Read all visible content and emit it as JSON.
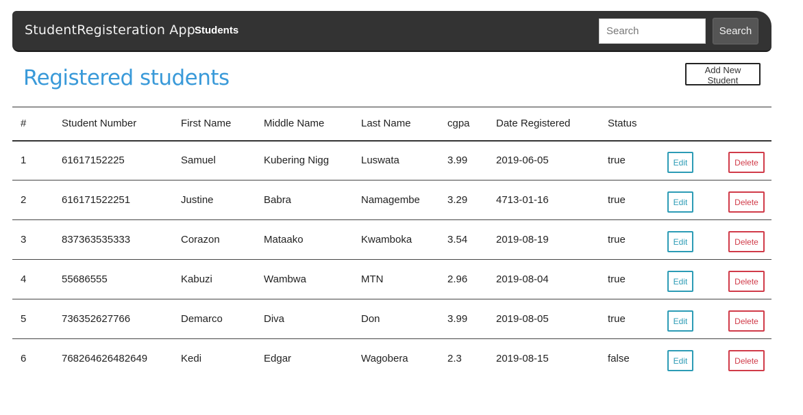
{
  "navbar": {
    "brand": "StudentRegisteration App",
    "links": [
      {
        "label": "Students"
      }
    ],
    "search": {
      "placeholder": "Search",
      "button_label": "Search"
    }
  },
  "main": {
    "title": "Registered students",
    "add_button_label": "Add New Student"
  },
  "table": {
    "columns": [
      "#",
      "Student Number",
      "First Name",
      "Middle Name",
      "Last Name",
      "cgpa",
      "Date Registered",
      "Status"
    ],
    "edit_label": "Edit",
    "delete_label": "Delete",
    "rows": [
      {
        "num": "1",
        "student_number": "61617152225",
        "first_name": "Samuel",
        "middle_name": "Kubering Nigg",
        "last_name": "Luswata",
        "cgpa": "3.99",
        "date_registered": "2019-06-05",
        "status": "true"
      },
      {
        "num": "2",
        "student_number": "616171522251",
        "first_name": "Justine",
        "middle_name": "Babra",
        "last_name": "Namagembe",
        "cgpa": "3.29",
        "date_registered": "4713-01-16",
        "status": "true"
      },
      {
        "num": "3",
        "student_number": "837363535333",
        "first_name": "Corazon",
        "middle_name": "Mataako",
        "last_name": "Kwamboka",
        "cgpa": "3.54",
        "date_registered": "2019-08-19",
        "status": "true"
      },
      {
        "num": "4",
        "student_number": "55686555",
        "first_name": "Kabuzi",
        "middle_name": "Wambwa",
        "last_name": "MTN",
        "cgpa": "2.96",
        "date_registered": "2019-08-04",
        "status": "true"
      },
      {
        "num": "5",
        "student_number": "736352627766",
        "first_name": "Demarco",
        "middle_name": "Diva",
        "last_name": "Don",
        "cgpa": "3.99",
        "date_registered": "2019-08-05",
        "status": "true"
      },
      {
        "num": "6",
        "student_number": "768264626482649",
        "first_name": "Kedi",
        "middle_name": "Edgar",
        "last_name": "Wagobera",
        "cgpa": "2.3",
        "date_registered": "2019-08-15",
        "status": "false"
      }
    ]
  }
}
